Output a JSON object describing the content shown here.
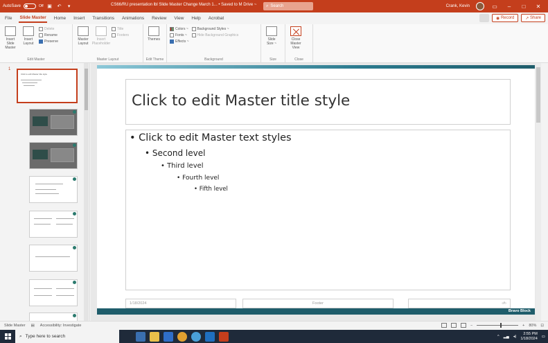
{
  "titlebar": {
    "autosave_label": "AutoSave",
    "autosave_state": "Off",
    "doc_title": "CS66/RU presentation lbl Slide Master Change March 1... • Saved to M Drive ~",
    "search_placeholder": "Search",
    "user_name": "Crank, Kevin",
    "color": "#c43e1c"
  },
  "tabs": {
    "items": [
      "File",
      "Slide Master",
      "Home",
      "Insert",
      "Transitions",
      "Animations",
      "Review",
      "View",
      "Help",
      "Acrobat"
    ],
    "active": "Slide Master",
    "record_label": "Record",
    "share_label": "Share"
  },
  "ribbon": {
    "edit_master": {
      "label": "Edit Master",
      "insert_slide_master": "Insert Slide Master",
      "insert_layout": "Insert Layout",
      "delete": "Delete",
      "rename": "Rename",
      "preserve": "Preserve"
    },
    "master_layout": {
      "label": "Master Layout",
      "master_layout": "Master Layout",
      "insert_placeholder": "Insert Placeholder",
      "title": "Title",
      "footers": "Footers"
    },
    "edit_theme": {
      "label": "Edit Theme",
      "themes": "Themes"
    },
    "background": {
      "label": "Background",
      "colors": "Colors ~",
      "fonts": "Fonts ~",
      "effects": "Effects ~",
      "background_styles": "Background Styles ~",
      "hide_background": "Hide Background Graphics"
    },
    "size": {
      "label": "Size",
      "slide_size": "Slide Size ~"
    },
    "close": {
      "label": "Close",
      "close_master_view": "Close Master View"
    }
  },
  "thumbnails": {
    "selected_number": "1",
    "master_title": "Click to edit Master title style"
  },
  "slide": {
    "title": "Click to edit Master title style",
    "levels": [
      "• Click to edit Master text styles",
      "• Second level",
      "• Third level",
      "• Fourth level",
      "• Fifth level"
    ],
    "footer_date": "1/18/2024",
    "footer_text": "Footer",
    "footer_num": "‹#›",
    "brand": "Bravo Block"
  },
  "status": {
    "mode": "Slide Master",
    "accessibility": "Accessibility: Investigate",
    "zoom": "80%"
  },
  "taskbar": {
    "search_placeholder": "Type here to search",
    "time": "2:55 PM",
    "date": "1/18/2024"
  }
}
